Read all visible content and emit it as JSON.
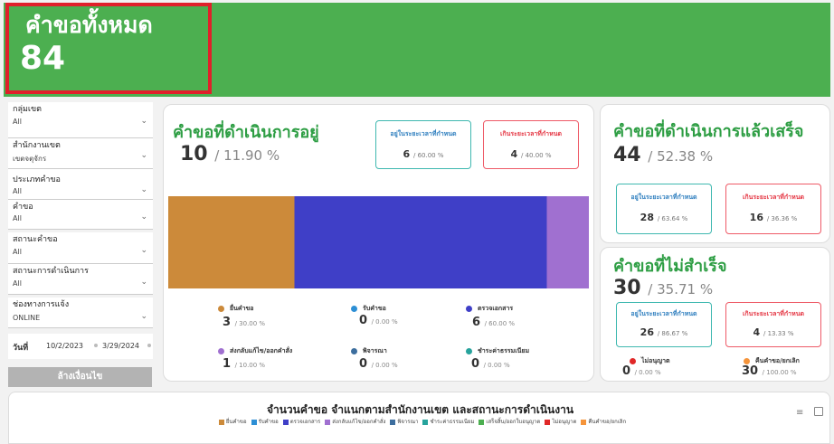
{
  "header": {
    "total_label": "คำขอทั้งหมด",
    "total_value": "84",
    "banner_color": "#4caf50",
    "highlight_color": "#e0202a"
  },
  "filters": [
    {
      "label": "กลุ่มเขต",
      "value": "All"
    },
    {
      "label": "สำนักงานเขต",
      "value": "เขตจตุจักร"
    },
    {
      "label": "ประเภทคำขอ",
      "value": "All"
    },
    {
      "label": "คำขอ",
      "value": "All"
    },
    {
      "label": "สถานะคำขอ",
      "value": "All"
    },
    {
      "label": "สถานะการดำเนินการ",
      "value": "All"
    },
    {
      "label": "ช่องทางการแจ้ง",
      "value": "ONLINE"
    }
  ],
  "date_filter": {
    "label": "วันที่",
    "from": "10/2/2023",
    "to": "3/29/2024"
  },
  "clear_button": "ล้างเงื่อนไข",
  "in_progress": {
    "title": "คำขอที่ดำเนินการอยู่",
    "count": "10",
    "percent": "/ 11.90 %",
    "within": {
      "label": "อยู่ในระยะเวลาที่กำหนด",
      "count": "6",
      "percent": "/ 60.00 %"
    },
    "over": {
      "label": "เกินระยะเวลาที่กำหนด",
      "count": "4",
      "percent": "/ 40.00 %"
    },
    "legend": [
      {
        "name": "ยื่นคำขอ",
        "count": "3",
        "percent": "/ 30.00 %",
        "color": "#cc8a3a"
      },
      {
        "name": "รับคำขอ",
        "count": "0",
        "percent": "/ 0.00 %",
        "color": "#2d8fd5"
      },
      {
        "name": "ตรวจเอกสาร",
        "count": "6",
        "percent": "/ 60.00 %",
        "color": "#3f3fc7"
      },
      {
        "name": "ส่งกลับแก้ไข/ออกคำสั่ง",
        "count": "1",
        "percent": "/ 10.00 %",
        "color": "#a070d0"
      },
      {
        "name": "พิจารณา",
        "count": "0",
        "percent": "/ 0.00 %",
        "color": "#3d6e9e"
      },
      {
        "name": "ชำระค่าธรรมเนียม",
        "count": "0",
        "percent": "/ 0.00 %",
        "color": "#27a39c"
      }
    ]
  },
  "chart_data": {
    "type": "bar",
    "stacked": true,
    "orientation": "horizontal",
    "categories": [
      ""
    ],
    "series": [
      {
        "name": "ยื่นคำขอ",
        "values": [
          3
        ],
        "color": "#cc8a3a"
      },
      {
        "name": "รับคำขอ",
        "values": [
          0
        ],
        "color": "#2d8fd5"
      },
      {
        "name": "ตรวจเอกสาร",
        "values": [
          6
        ],
        "color": "#3f3fc7"
      },
      {
        "name": "ส่งกลับแก้ไข/ออกคำสั่ง",
        "values": [
          1
        ],
        "color": "#a070d0"
      },
      {
        "name": "พิจารณา",
        "values": [
          0
        ],
        "color": "#3d6e9e"
      },
      {
        "name": "ชำระค่าธรรมเนียม",
        "values": [
          0
        ],
        "color": "#27a39c"
      }
    ],
    "xlim": [
      0,
      10
    ]
  },
  "completed": {
    "title": "คำขอที่ดำเนินการแล้วเสร็จ",
    "count": "44",
    "percent": "/ 52.38 %",
    "within": {
      "label": "อยู่ในระยะเวลาที่กำหนด",
      "count": "28",
      "percent": "/ 63.64 %"
    },
    "over": {
      "label": "เกินระยะเวลาที่กำหนด",
      "count": "16",
      "percent": "/ 36.36 %"
    }
  },
  "failed": {
    "title": "คำขอที่ไม่สำเร็จ",
    "count": "30",
    "percent": "/ 35.71 %",
    "within": {
      "label": "อยู่ในระยะเวลาที่กำหนด",
      "count": "26",
      "percent": "/ 86.67 %"
    },
    "over": {
      "label": "เกินระยะเวลาที่กำหนด",
      "count": "4",
      "percent": "/ 13.33 %"
    },
    "legend": [
      {
        "name": "ไม่อนุญาต",
        "count": "0",
        "percent": "/ 0.00 %",
        "color": "#e02828"
      },
      {
        "name": "คืนคำขอ/ยกเลิก",
        "count": "30",
        "percent": "/ 100.00 %",
        "color": "#f5943a"
      }
    ]
  },
  "bottom_chart": {
    "title": "จำนวนคำขอ  จำแนกตามสำนักงานเขต และสถานะการดำเนินงาน",
    "legend": [
      {
        "name": "ยื่นคำขอ",
        "color": "#cc8a3a"
      },
      {
        "name": "รับคำขอ",
        "color": "#2d8fd5"
      },
      {
        "name": "ตรวจเอกสาร",
        "color": "#3f3fc7"
      },
      {
        "name": "ส่งกลับแก้ไข/ออกคำสั่ง",
        "color": "#a070d0"
      },
      {
        "name": "พิจารณา",
        "color": "#3d6e9e"
      },
      {
        "name": "ชำระค่าธรรมเนียม",
        "color": "#27a39c"
      },
      {
        "name": "เสร็จสิ้น/ออกใบอนุญาต",
        "color": "#4caf50"
      },
      {
        "name": "ไม่อนุญาต",
        "color": "#e02828"
      },
      {
        "name": "คืนคำขอ/ยกเลิก",
        "color": "#f5943a"
      }
    ]
  }
}
